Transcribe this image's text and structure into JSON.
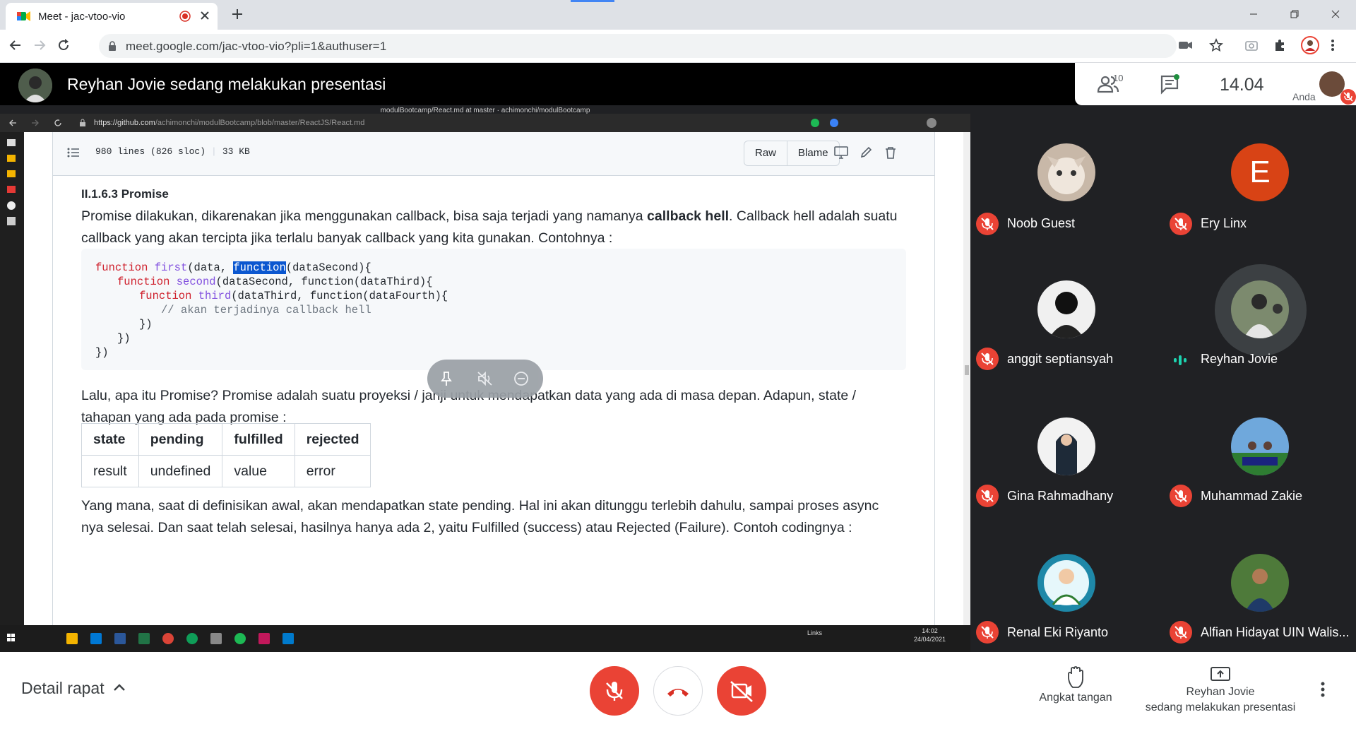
{
  "browser": {
    "tab_title": "Meet - jac-vtoo-vio",
    "url": "meet.google.com/jac-vtoo-vio?pli=1&authuser=1"
  },
  "meet": {
    "presentation_title": "Reyhan Jovie sedang melakukan presentasi",
    "people_count": "10",
    "clock": "14.04",
    "self_label": "Anda",
    "meeting_details_label": "Detail rapat",
    "raise_hand_label": "Angkat tangan",
    "presenting_label_line1": "Reyhan Jovie",
    "presenting_label_line2": "sedang melakukan presentasi",
    "accent_red": "#ea4335"
  },
  "participants": [
    {
      "name": "Noob Guest",
      "muted": true,
      "avatar": "cat-photo"
    },
    {
      "name": "Ery Linx",
      "muted": true,
      "avatar": "letter-E",
      "initial": "E",
      "color": "#d84315"
    },
    {
      "name": "anggit septiansyah",
      "muted": true,
      "avatar": "anime-photo"
    },
    {
      "name": "Reyhan Jovie",
      "muted": false,
      "speaking": true,
      "avatar": "group-photo"
    },
    {
      "name": "Gina Rahmadhany",
      "muted": true,
      "avatar": "hijab-photo"
    },
    {
      "name": "Muhammad Zakie",
      "muted": true,
      "avatar": "field-photo"
    },
    {
      "name": "Renal Eki Riyanto",
      "muted": true,
      "avatar": "cartoon-photo"
    },
    {
      "name": "Alfian Hidayat UIN Walis...",
      "muted": true,
      "avatar": "portrait-photo"
    }
  ],
  "shared_screen": {
    "window_title": "modulBootcamp/React.md at master · achimonchi/modulBootcamp",
    "url_host": "https://github.com",
    "url_path": "/achimonchi/modulBootcamp/blob/master/ReactJS/React.md",
    "file_lines": "980 lines (826 sloc)",
    "file_size": "33 KB",
    "raw_label": "Raw",
    "blame_label": "Blame",
    "heading": "II.1.6.3 Promise",
    "para1_a": "Promise dilakukan, dikarenakan jika menggunakan callback, bisa saja terjadi yang namanya ",
    "para1_bold": "callback hell",
    "para1_b": ". Callback hell adalah suatu",
    "para1_line2": "callback yang akan tercipta jika terlalu banyak callback yang kita gunakan. Contohnya :",
    "code": {
      "l1_kw": "function",
      "l1_fn": "first",
      "l1_a": "(data, ",
      "l1_sel": "function",
      "l1_b": "(dataSecond){",
      "l2_kw": "function",
      "l2_fn": "second",
      "l2_a": "(dataSecond, function(dataThird){",
      "l3_kw": "function",
      "l3_fn": "third",
      "l3_a": "(dataThird, function(dataFourth){",
      "l4": "// akan terjadinya callback hell",
      "l5": "})",
      "l6": "})",
      "l7": "})"
    },
    "para2_line1": "Lalu, apa itu Promise? Promise adalah suatu proyeksi / janji untuk mendapatkan data yang ada di masa depan. Adapun, state /",
    "para2_line2": "tahapan yang ada pada promise :",
    "table_headers": [
      "state",
      "pending",
      "fulfilled",
      "rejected"
    ],
    "table_row": [
      "result",
      "undefined",
      "value",
      "error"
    ],
    "para3_line1": "Yang mana, saat di definisikan awal, akan mendapatkan state pending. Hal ini akan ditunggu terlebih dahulu, sampai proses async",
    "para3_line2": "nya selesai. Dan saat telah selesai, hasilnya hanya ada 2, yaitu Fulfilled (success) atau Rejected (Failure). Contoh codingnya :",
    "taskbar_links": "Links",
    "taskbar_time": "14:02",
    "taskbar_date": "24/04/2021"
  }
}
